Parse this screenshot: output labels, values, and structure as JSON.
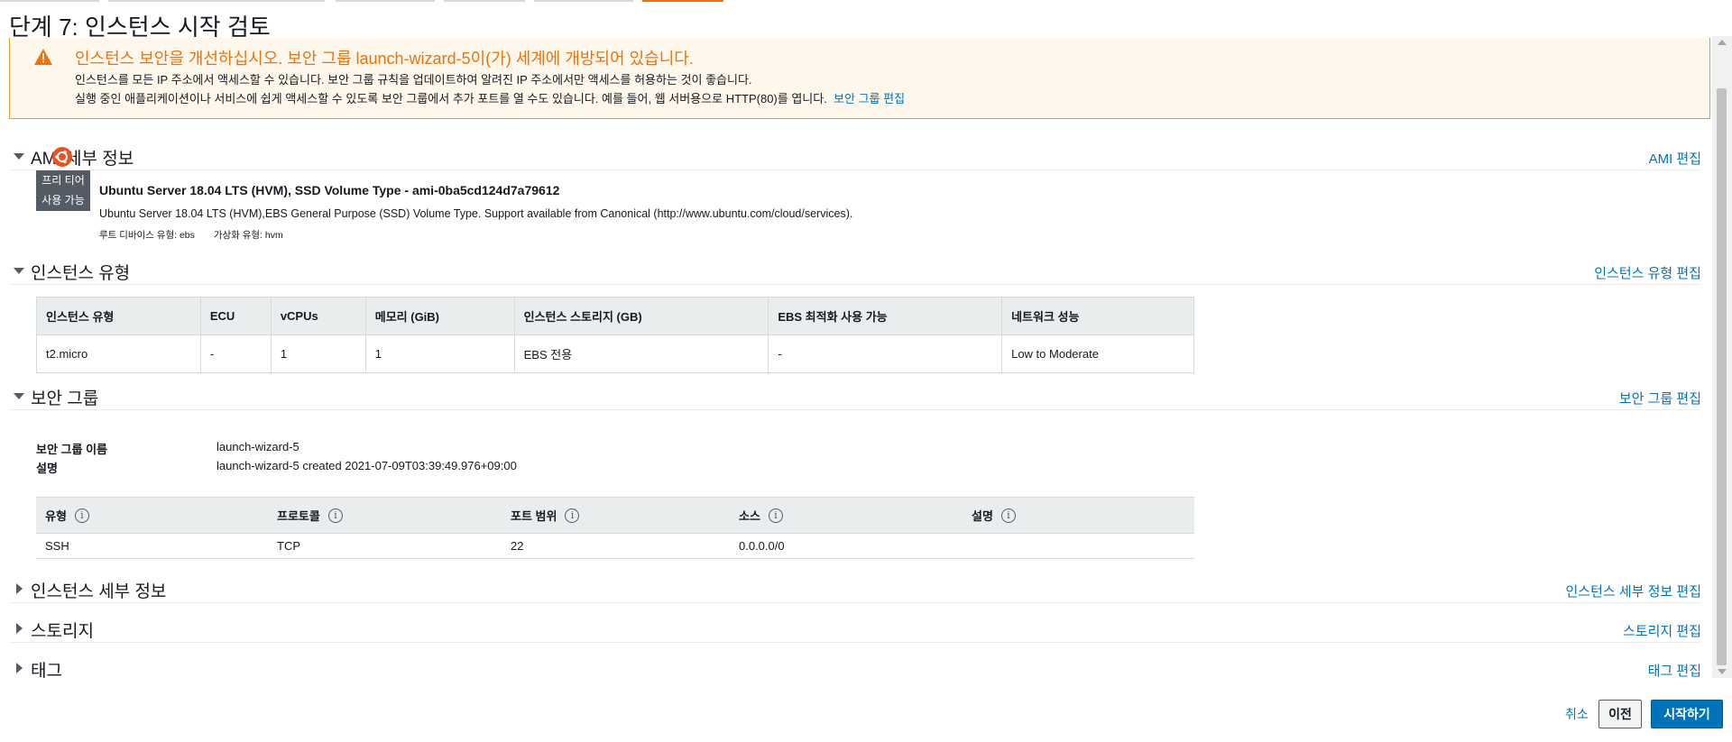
{
  "page_title": "단계 7: 인스턴스 시작 검토",
  "warning": {
    "title": "인스턴스 보안을 개선하십시오. 보안 그룹 launch-wizard-5이(가) 세계에 개방되어 있습니다.",
    "line1": "인스턴스를 모든 IP 주소에서 액세스할 수 있습니다. 보안 그룹 규칙을 업데이트하여 알려진 IP 주소에서만 액세스를 허용하는 것이 좋습니다.",
    "line2": "실행 중인 애플리케이션이나 서비스에 쉽게 액세스할 수 있도록 보안 그룹에서 추가 포트를 열 수도 있습니다. 예를 들어, 웹 서버용으로 HTTP(80)를 엽니다.",
    "link": "보안 그룹 편집"
  },
  "ami": {
    "section_title": "AMI 세부 정보",
    "edit": "AMI 편집",
    "badge_line1": "프리 티어",
    "badge_line2": "사용 가능",
    "name": "Ubuntu Server 18.04 LTS (HVM), SSD Volume Type - ami-0ba5cd124d7a79612",
    "description": "Ubuntu Server 18.04 LTS (HVM),EBS General Purpose (SSD) Volume Type. Support available from Canonical (http://www.ubuntu.com/cloud/services).",
    "root_device": "루트 디바이스 유형: ebs",
    "virtualization": "가상화 유형: hvm"
  },
  "instance_type": {
    "section_title": "인스턴스 유형",
    "edit": "인스턴스 유형 편집",
    "headers": [
      "인스턴스 유형",
      "ECU",
      "vCPUs",
      "메모리 (GiB)",
      "인스턴스 스토리지 (GB)",
      "EBS 최적화 사용 가능",
      "네트워크 성능"
    ],
    "row": [
      "t2.micro",
      "-",
      "1",
      "1",
      "EBS 전용",
      "-",
      "Low to Moderate"
    ]
  },
  "security_group": {
    "section_title": "보안 그룹",
    "edit": "보안 그룹 편집",
    "name_label": "보안 그룹 이름",
    "name_value": "launch-wizard-5",
    "desc_label": "설명",
    "desc_value": "launch-wizard-5 created 2021-07-09T03:39:49.976+09:00",
    "headers": [
      "유형",
      "프로토콜",
      "포트 범위",
      "소스",
      "설명"
    ],
    "row": [
      "SSH",
      "TCP",
      "22",
      "0.0.0.0/0",
      ""
    ]
  },
  "instance_details": {
    "section_title": "인스턴스 세부 정보",
    "edit": "인스턴스 세부 정보 편집"
  },
  "storage": {
    "section_title": "스토리지",
    "edit": "스토리지 편집"
  },
  "tags": {
    "section_title": "태그",
    "edit": "태그 편집"
  },
  "footer": {
    "cancel": "취소",
    "previous": "이전",
    "launch": "시작하기"
  },
  "colors": {
    "accent": "#ec7211",
    "link": "#0073bb",
    "primary_button": "#0073bb",
    "warning_bg": "#fef8ec"
  },
  "icons": {
    "warning": "warning-icon",
    "ubuntu": "ubuntu-logo-icon",
    "info": "info-icon",
    "caret_down": "caret-down-icon",
    "caret_right": "caret-right-icon"
  }
}
